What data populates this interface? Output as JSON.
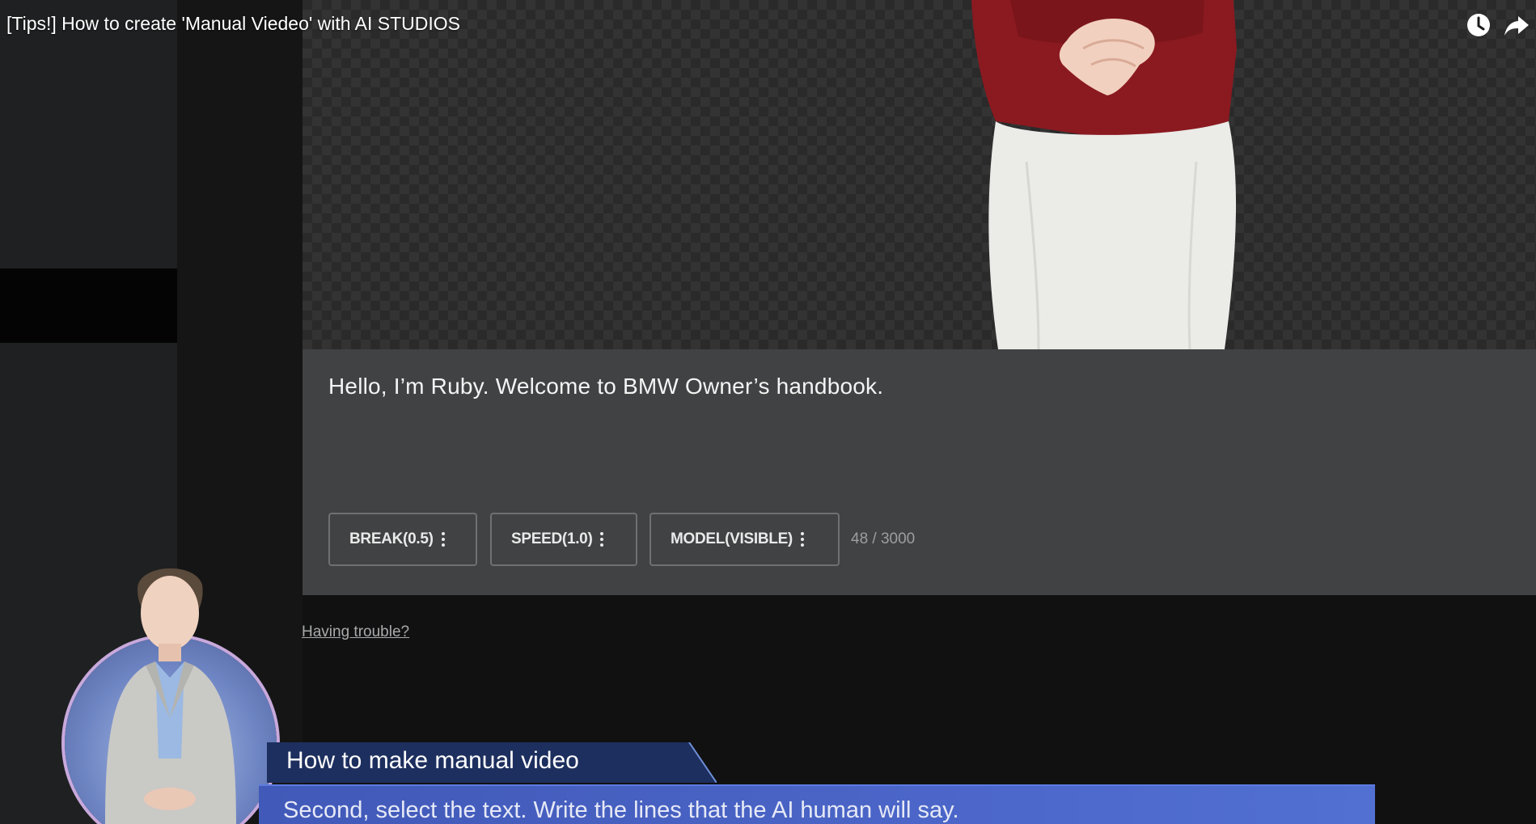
{
  "video": {
    "title": "[Tips!] How to create 'Manual Viedeo' with AI STUDIOS",
    "icons": [
      "watch-later-icon",
      "share-icon"
    ]
  },
  "editor": {
    "script_text": "Hello, I’m Ruby. Welcome to BMW Owner’s handbook.",
    "buttons": [
      {
        "label": "BREAK(0.5)"
      },
      {
        "label": "SPEED(1.0)"
      },
      {
        "label": "MODEL(VISIBLE)"
      }
    ],
    "char_count": "48 / 3000"
  },
  "help": {
    "trouble_link": "Having trouble?"
  },
  "lower_third": {
    "heading": "How to make manual video",
    "caption": "Second, select the text. Write the lines that the AI human will say."
  },
  "colors": {
    "editor_bg": "#414243",
    "caption_blue": "#4b66c8",
    "heading_navy": "#1d2f5e",
    "presenter_top": "#8e1a1f"
  }
}
